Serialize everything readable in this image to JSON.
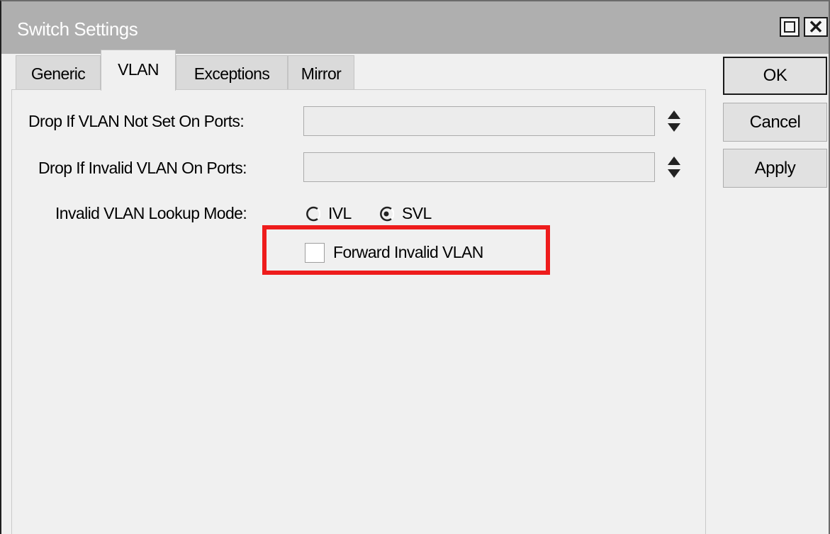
{
  "window": {
    "title": "Switch Settings",
    "maximize_icon": "maximize-icon",
    "close_icon": "close-icon",
    "close_glyph": "✕"
  },
  "tabs": [
    {
      "label": "Generic",
      "active": false
    },
    {
      "label": "VLAN",
      "active": true
    },
    {
      "label": "Exceptions",
      "active": false
    },
    {
      "label": "Mirror",
      "active": false
    }
  ],
  "form": {
    "drop_not_set": {
      "label": "Drop If VLAN Not Set On Ports:",
      "value": ""
    },
    "drop_invalid": {
      "label": "Drop If Invalid VLAN On Ports:",
      "value": ""
    },
    "lookup_mode": {
      "label": "Invalid VLAN Lookup Mode:",
      "options": [
        {
          "label": "IVL",
          "selected": false
        },
        {
          "label": "SVL",
          "selected": true
        }
      ]
    },
    "forward_invalid": {
      "label": "Forward Invalid VLAN",
      "checked": false
    }
  },
  "buttons": {
    "ok": "OK",
    "cancel": "Cancel",
    "apply": "Apply"
  },
  "colors": {
    "highlight": "#ee1c1c",
    "titlebar": "#afafaf"
  }
}
